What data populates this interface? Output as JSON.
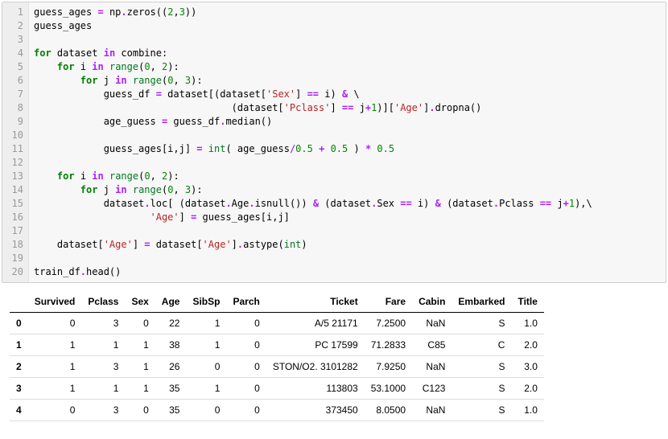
{
  "code": {
    "lines": [
      [
        {
          "t": "guess_ages ",
          "c": "name"
        },
        {
          "t": "=",
          "c": "op"
        },
        {
          "t": " np",
          "c": "name"
        },
        {
          "t": ".",
          "c": "op"
        },
        {
          "t": "zeros((",
          "c": "name"
        },
        {
          "t": "2",
          "c": "num"
        },
        {
          "t": ",",
          "c": "name"
        },
        {
          "t": "3",
          "c": "num"
        },
        {
          "t": "))",
          "c": "name"
        }
      ],
      [
        {
          "t": "guess_ages",
          "c": "name"
        }
      ],
      [],
      [
        {
          "t": "for",
          "c": "kw"
        },
        {
          "t": " dataset ",
          "c": "name"
        },
        {
          "t": "in",
          "c": "op"
        },
        {
          "t": " combine:",
          "c": "name"
        }
      ],
      [
        {
          "t": "    ",
          "c": "name"
        },
        {
          "t": "for",
          "c": "kw"
        },
        {
          "t": " i ",
          "c": "name"
        },
        {
          "t": "in",
          "c": "op"
        },
        {
          "t": " ",
          "c": "name"
        },
        {
          "t": "range",
          "c": "builtin"
        },
        {
          "t": "(",
          "c": "name"
        },
        {
          "t": "0",
          "c": "num"
        },
        {
          "t": ", ",
          "c": "name"
        },
        {
          "t": "2",
          "c": "num"
        },
        {
          "t": "):",
          "c": "name"
        }
      ],
      [
        {
          "t": "        ",
          "c": "name"
        },
        {
          "t": "for",
          "c": "kw"
        },
        {
          "t": " j ",
          "c": "name"
        },
        {
          "t": "in",
          "c": "op"
        },
        {
          "t": " ",
          "c": "name"
        },
        {
          "t": "range",
          "c": "builtin"
        },
        {
          "t": "(",
          "c": "name"
        },
        {
          "t": "0",
          "c": "num"
        },
        {
          "t": ", ",
          "c": "name"
        },
        {
          "t": "3",
          "c": "num"
        },
        {
          "t": "):",
          "c": "name"
        }
      ],
      [
        {
          "t": "            guess_df ",
          "c": "name"
        },
        {
          "t": "=",
          "c": "op"
        },
        {
          "t": " dataset[(dataset[",
          "c": "name"
        },
        {
          "t": "'Sex'",
          "c": "str"
        },
        {
          "t": "] ",
          "c": "name"
        },
        {
          "t": "==",
          "c": "op"
        },
        {
          "t": " i) ",
          "c": "name"
        },
        {
          "t": "&",
          "c": "op"
        },
        {
          "t": " \\",
          "c": "name"
        }
      ],
      [
        {
          "t": "                                  (dataset[",
          "c": "name"
        },
        {
          "t": "'Pclass'",
          "c": "str"
        },
        {
          "t": "] ",
          "c": "name"
        },
        {
          "t": "==",
          "c": "op"
        },
        {
          "t": " j",
          "c": "name"
        },
        {
          "t": "+",
          "c": "op"
        },
        {
          "t": "1",
          "c": "num"
        },
        {
          "t": ")][",
          "c": "name"
        },
        {
          "t": "'Age'",
          "c": "str"
        },
        {
          "t": "]",
          "c": "name"
        },
        {
          "t": ".",
          "c": "op"
        },
        {
          "t": "dropna()",
          "c": "name"
        }
      ],
      [
        {
          "t": "            age_guess ",
          "c": "name"
        },
        {
          "t": "=",
          "c": "op"
        },
        {
          "t": " guess_df",
          "c": "name"
        },
        {
          "t": ".",
          "c": "op"
        },
        {
          "t": "median()",
          "c": "name"
        }
      ],
      [],
      [
        {
          "t": "            guess_ages[i,j] ",
          "c": "name"
        },
        {
          "t": "=",
          "c": "op"
        },
        {
          "t": " ",
          "c": "name"
        },
        {
          "t": "int",
          "c": "builtin"
        },
        {
          "t": "( age_guess",
          "c": "name"
        },
        {
          "t": "/",
          "c": "op"
        },
        {
          "t": "0.5",
          "c": "num"
        },
        {
          "t": " ",
          "c": "name"
        },
        {
          "t": "+",
          "c": "op"
        },
        {
          "t": " ",
          "c": "name"
        },
        {
          "t": "0.5",
          "c": "num"
        },
        {
          "t": " ) ",
          "c": "name"
        },
        {
          "t": "*",
          "c": "op"
        },
        {
          "t": " ",
          "c": "name"
        },
        {
          "t": "0.5",
          "c": "num"
        }
      ],
      [],
      [
        {
          "t": "    ",
          "c": "name"
        },
        {
          "t": "for",
          "c": "kw"
        },
        {
          "t": " i ",
          "c": "name"
        },
        {
          "t": "in",
          "c": "op"
        },
        {
          "t": " ",
          "c": "name"
        },
        {
          "t": "range",
          "c": "builtin"
        },
        {
          "t": "(",
          "c": "name"
        },
        {
          "t": "0",
          "c": "num"
        },
        {
          "t": ", ",
          "c": "name"
        },
        {
          "t": "2",
          "c": "num"
        },
        {
          "t": "):",
          "c": "name"
        }
      ],
      [
        {
          "t": "        ",
          "c": "name"
        },
        {
          "t": "for",
          "c": "kw"
        },
        {
          "t": " j ",
          "c": "name"
        },
        {
          "t": "in",
          "c": "op"
        },
        {
          "t": " ",
          "c": "name"
        },
        {
          "t": "range",
          "c": "builtin"
        },
        {
          "t": "(",
          "c": "name"
        },
        {
          "t": "0",
          "c": "num"
        },
        {
          "t": ", ",
          "c": "name"
        },
        {
          "t": "3",
          "c": "num"
        },
        {
          "t": "):",
          "c": "name"
        }
      ],
      [
        {
          "t": "            dataset",
          "c": "name"
        },
        {
          "t": ".",
          "c": "op"
        },
        {
          "t": "loc[ (dataset",
          "c": "name"
        },
        {
          "t": ".",
          "c": "op"
        },
        {
          "t": "Age",
          "c": "name"
        },
        {
          "t": ".",
          "c": "op"
        },
        {
          "t": "isnull()) ",
          "c": "name"
        },
        {
          "t": "&",
          "c": "op"
        },
        {
          "t": " (dataset",
          "c": "name"
        },
        {
          "t": ".",
          "c": "op"
        },
        {
          "t": "Sex ",
          "c": "name"
        },
        {
          "t": "==",
          "c": "op"
        },
        {
          "t": " i) ",
          "c": "name"
        },
        {
          "t": "&",
          "c": "op"
        },
        {
          "t": " (dataset",
          "c": "name"
        },
        {
          "t": ".",
          "c": "op"
        },
        {
          "t": "Pclass ",
          "c": "name"
        },
        {
          "t": "==",
          "c": "op"
        },
        {
          "t": " j",
          "c": "name"
        },
        {
          "t": "+",
          "c": "op"
        },
        {
          "t": "1",
          "c": "num"
        },
        {
          "t": "),\\",
          "c": "name"
        }
      ],
      [
        {
          "t": "                    ",
          "c": "name"
        },
        {
          "t": "'Age'",
          "c": "str"
        },
        {
          "t": "] ",
          "c": "name"
        },
        {
          "t": "=",
          "c": "op"
        },
        {
          "t": " guess_ages[i,j]",
          "c": "name"
        }
      ],
      [],
      [
        {
          "t": "    dataset[",
          "c": "name"
        },
        {
          "t": "'Age'",
          "c": "str"
        },
        {
          "t": "] ",
          "c": "name"
        },
        {
          "t": "=",
          "c": "op"
        },
        {
          "t": " dataset[",
          "c": "name"
        },
        {
          "t": "'Age'",
          "c": "str"
        },
        {
          "t": "]",
          "c": "name"
        },
        {
          "t": ".",
          "c": "op"
        },
        {
          "t": "astype(",
          "c": "name"
        },
        {
          "t": "int",
          "c": "builtin"
        },
        {
          "t": ")",
          "c": "name"
        }
      ],
      [],
      [
        {
          "t": "train_df",
          "c": "name"
        },
        {
          "t": ".",
          "c": "op"
        },
        {
          "t": "head()",
          "c": "name"
        }
      ]
    ]
  },
  "dataframe": {
    "columns": [
      "Survived",
      "Pclass",
      "Sex",
      "Age",
      "SibSp",
      "Parch",
      "Ticket",
      "Fare",
      "Cabin",
      "Embarked",
      "Title"
    ],
    "index": [
      "0",
      "1",
      "2",
      "3",
      "4"
    ],
    "rows": [
      [
        "0",
        "3",
        "0",
        "22",
        "1",
        "0",
        "A/5 21171",
        "7.2500",
        "NaN",
        "S",
        "1.0"
      ],
      [
        "1",
        "1",
        "1",
        "38",
        "1",
        "0",
        "PC 17599",
        "71.2833",
        "C85",
        "C",
        "2.0"
      ],
      [
        "1",
        "3",
        "1",
        "26",
        "0",
        "0",
        "STON/O2. 3101282",
        "7.9250",
        "NaN",
        "S",
        "3.0"
      ],
      [
        "1",
        "1",
        "1",
        "35",
        "1",
        "0",
        "113803",
        "53.1000",
        "C123",
        "S",
        "2.0"
      ],
      [
        "0",
        "3",
        "0",
        "35",
        "0",
        "0",
        "373450",
        "8.0500",
        "NaN",
        "S",
        "1.0"
      ]
    ]
  }
}
